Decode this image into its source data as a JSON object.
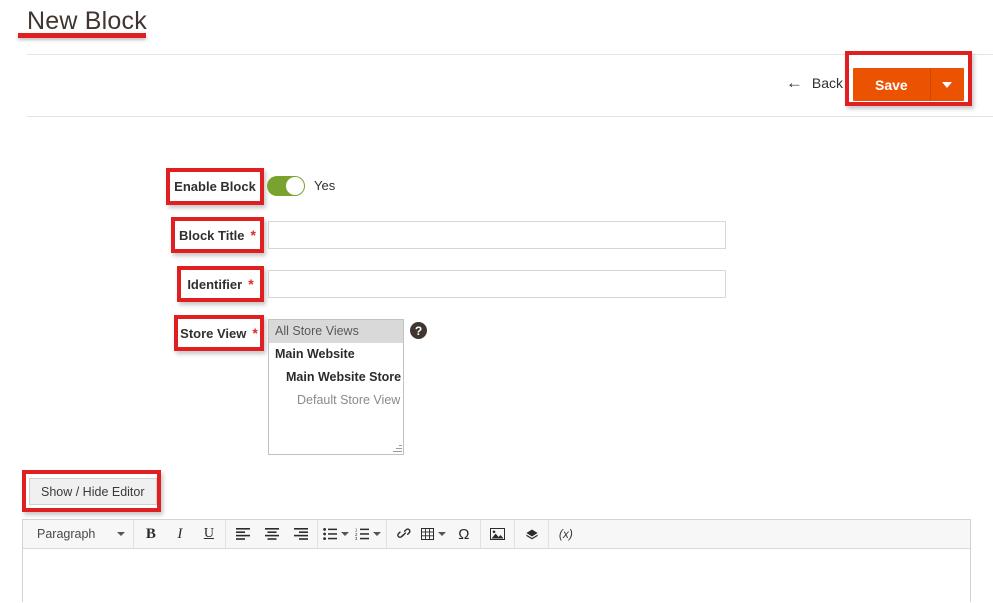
{
  "page": {
    "title": "New Block"
  },
  "header": {
    "back_label": "Back",
    "back_icon": "arrow-left-icon",
    "save_label": "Save",
    "save_caret_icon": "chevron-down-icon",
    "accent_color": "#eb5202",
    "annotation_color": "#e02020"
  },
  "form": {
    "enable_block": {
      "label": "Enable Block",
      "toggle_value": "Yes",
      "toggle_on": true,
      "toggle_color": "#79a22e"
    },
    "block_title": {
      "label": "Block Title",
      "required_marker": "*",
      "value": "",
      "placeholder": ""
    },
    "identifier": {
      "label": "Identifier",
      "required_marker": "*",
      "value": "",
      "placeholder": ""
    },
    "store_view": {
      "label": "Store View",
      "required_marker": "*",
      "help_icon": "question-mark-icon",
      "options": [
        {
          "label": "All Store Views",
          "level": 0,
          "selected": true
        },
        {
          "label": "Main Website",
          "level": 1,
          "selected": false
        },
        {
          "label": "Main Website Store",
          "level": 2,
          "selected": false
        },
        {
          "label": "Default Store View",
          "level": 3,
          "selected": false
        }
      ]
    }
  },
  "editor": {
    "show_hide_label": "Show / Hide Editor",
    "toolbar": {
      "format_select": "Paragraph",
      "buttons": [
        {
          "name": "bold-icon",
          "glyph": "B"
        },
        {
          "name": "italic-icon",
          "glyph": "I"
        },
        {
          "name": "underline-icon",
          "glyph": "U"
        },
        {
          "name": "align-left-icon",
          "glyph": ""
        },
        {
          "name": "align-center-icon",
          "glyph": ""
        },
        {
          "name": "align-right-icon",
          "glyph": ""
        },
        {
          "name": "bullet-list-icon",
          "glyph": ""
        },
        {
          "name": "numbered-list-icon",
          "glyph": ""
        },
        {
          "name": "link-icon",
          "glyph": ""
        },
        {
          "name": "table-icon",
          "glyph": ""
        },
        {
          "name": "special-character-icon",
          "glyph": "Ω"
        },
        {
          "name": "insert-image-icon",
          "glyph": ""
        },
        {
          "name": "insert-widget-icon",
          "glyph": ""
        },
        {
          "name": "insert-variable-icon",
          "glyph": "(x)"
        }
      ]
    },
    "content": ""
  }
}
